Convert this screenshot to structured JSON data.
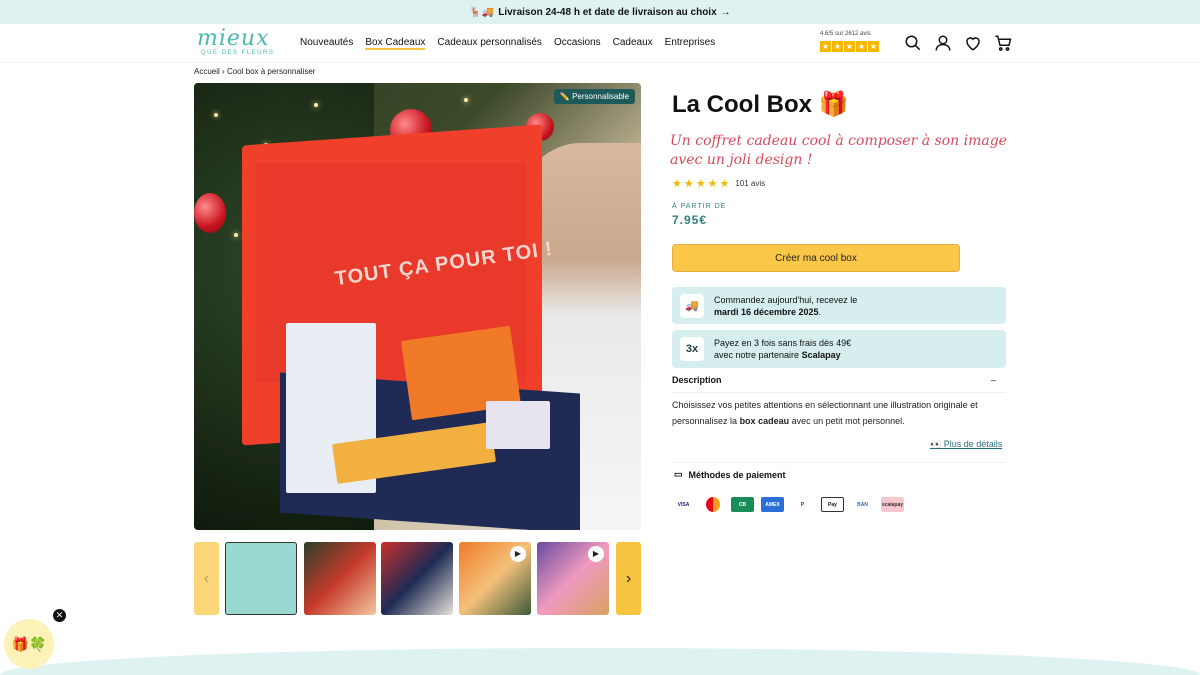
{
  "announcement": {
    "text": "Livraison 24-48 h et date de livraison au choix",
    "icons": [
      "reindeer-emoji",
      "truck-emoji",
      "arrow-right-icon"
    ]
  },
  "header": {
    "logo": {
      "word": "mieux",
      "sub": "QUE DES FLEURS"
    },
    "nav": [
      "Nouveautés",
      "Box Cadeaux",
      "Cadeaux personnalisés",
      "Occasions",
      "Cadeaux",
      "Entreprises"
    ],
    "active_nav": "Box Cadeaux",
    "rating": {
      "text": "4.6/5 sur 2612 avis",
      "stars": 5
    },
    "icons": [
      "search-icon",
      "account-icon",
      "heart-icon",
      "cart-icon"
    ]
  },
  "breadcrumb": {
    "home": "Accueil",
    "separator": "›",
    "current": "Cool box à personnaliser"
  },
  "gallery": {
    "badge": "✏️ Personnalisable",
    "hero_text": "TOUT ÇA POUR TOI !",
    "thumbnails": [
      {
        "video": false
      },
      {
        "video": false
      },
      {
        "video": false
      },
      {
        "video": true
      },
      {
        "video": true
      }
    ],
    "prev": "‹",
    "next": "›"
  },
  "product": {
    "title": "La Cool Box 🎁",
    "subtitle": "Un coffret cadeau cool à composer à son image avec un joli design !",
    "stars": "★★★★★",
    "reviews": "101 avis",
    "from_label": "À PARTIR DE",
    "price": "7.95€",
    "cta": "Créer ma cool box",
    "delivery": {
      "line1": "Commandez aujourd'hui, recevez le",
      "date": "mardi 16 décembre 2025",
      "end": "."
    },
    "payment_split": {
      "line1": "Payez en 3 fois sans frais dès 49€",
      "line2_prefix": "avec notre partenaire",
      "partner": "Scalapay",
      "icon_text": "3x"
    },
    "description": {
      "heading": "Description",
      "toggle": "–",
      "text_part1": "Choisissez vos petites attentions en sélectionnant une illustration originale et personnalisez la",
      "bold": "box cadeau",
      "text_part2": "avec un petit mot personnel.",
      "more": "👀 Plus de détails"
    },
    "payment_methods": {
      "heading": "Méthodes de paiement",
      "logos": [
        "VISA",
        "MC",
        "CB",
        "AMEX",
        "P",
        "Pay",
        "BAN",
        "scalapay"
      ]
    }
  },
  "widget": {
    "gift": "🎁🍀",
    "close": "✕"
  },
  "colors": {
    "accent": "#fbc748",
    "teal": "#46b8b0",
    "pink": "#d94a5c",
    "announce_bg": "#dff2f2"
  }
}
